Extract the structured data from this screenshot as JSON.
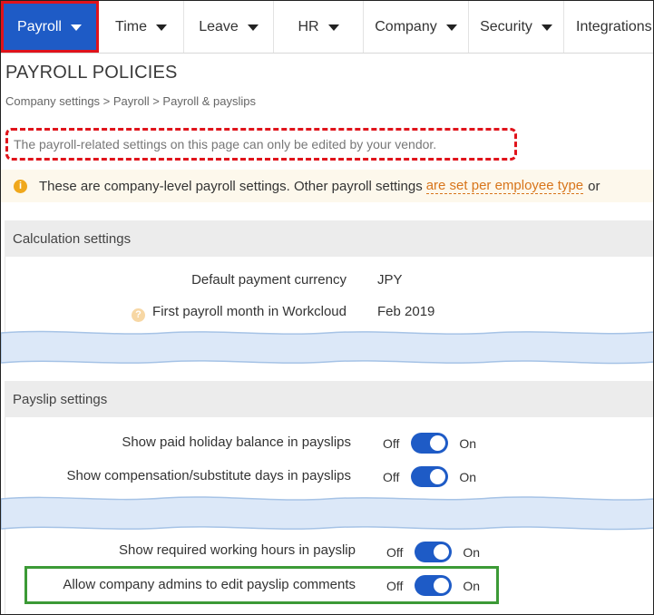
{
  "nav": {
    "items": [
      {
        "label": "Payroll",
        "active": true
      },
      {
        "label": "Time",
        "active": false
      },
      {
        "label": "Leave",
        "active": false
      },
      {
        "label": "HR",
        "active": false
      },
      {
        "label": "Company",
        "active": false
      },
      {
        "label": "Security",
        "active": false
      },
      {
        "label": "Integrations",
        "active": false
      }
    ]
  },
  "page": {
    "title": "PAYROLL POLICIES",
    "breadcrumb": "Company settings > Payroll > Payroll & payslips",
    "vendor_note": "The payroll-related settings on this page can only be edited by your vendor."
  },
  "info": {
    "icon": "info-icon",
    "text": "These are company-level payroll settings. Other payroll settings",
    "link": "are set per employee type",
    "tail": "or"
  },
  "calculation": {
    "header": "Calculation settings",
    "rows": [
      {
        "label": "Default payment currency",
        "value": "JPY"
      },
      {
        "label": "First payroll month in Workcloud",
        "value": "Feb 2019",
        "icon": "help-icon"
      }
    ]
  },
  "payslip": {
    "header": "Payslip settings",
    "off_label": "Off",
    "on_label": "On",
    "rows": [
      {
        "label": "Show paid holiday balance in payslips",
        "state": "On"
      },
      {
        "label": "Show compensation/substitute days in payslips",
        "state": "On"
      },
      {
        "label": "Show required working hours in payslip",
        "state": "On"
      },
      {
        "label": "Allow company admins to edit payslip comments",
        "state": "On"
      }
    ]
  },
  "colors": {
    "accent": "#1e5bc6",
    "red_highlight": "#e0131b",
    "green_highlight": "#3c9a36",
    "link": "#d8751b",
    "info_bg": "#fdf8ec"
  }
}
